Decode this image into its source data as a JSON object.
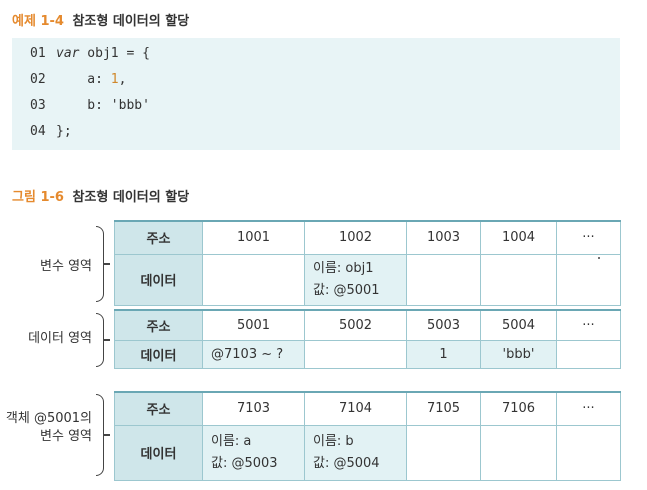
{
  "example": {
    "number": "예제 1-4",
    "title": "참조형 데이터의 할당"
  },
  "code": [
    {
      "ln": "01",
      "parts": [
        {
          "t": "kw",
          "v": "var"
        },
        {
          "t": "plain",
          "v": " obj1 = {"
        }
      ]
    },
    {
      "ln": "02",
      "parts": [
        {
          "t": "plain",
          "v": "    a: "
        },
        {
          "t": "num",
          "v": "1"
        },
        {
          "t": "plain",
          "v": ","
        }
      ]
    },
    {
      "ln": "03",
      "parts": [
        {
          "t": "plain",
          "v": "    b: "
        },
        {
          "t": "str",
          "v": "'bbb'"
        }
      ]
    },
    {
      "ln": "04",
      "parts": [
        {
          "t": "plain",
          "v": "};"
        }
      ]
    }
  ],
  "figure": {
    "number": "그림 1-6",
    "title": "참조형 데이터의 할당"
  },
  "labels": {
    "address": "주소",
    "data": "데이터",
    "more": "···"
  },
  "groups": [
    {
      "name": "변수 영역",
      "addresses": [
        "1001",
        "1002",
        "1003",
        "1004"
      ],
      "cells": [
        [],
        [
          "이름: obj1",
          "값:  @5001"
        ],
        [],
        []
      ],
      "fill": [
        false,
        true,
        false,
        false
      ]
    },
    {
      "name": "데이터 영역",
      "addresses": [
        "5001",
        "5002",
        "5003",
        "5004"
      ],
      "cells": [
        [
          "@7103 ~ ?"
        ],
        [],
        [
          "1"
        ],
        [
          "'bbb'"
        ]
      ],
      "fill": [
        true,
        false,
        true,
        true
      ]
    },
    {
      "name": "객체 @5001의\n변수 영역",
      "addresses": [
        "7103",
        "7104",
        "7105",
        "7106"
      ],
      "cells": [
        [
          "이름: a",
          "값:  @5003"
        ],
        [
          "이름: b",
          "값:  @5004"
        ],
        [],
        []
      ],
      "fill": [
        true,
        true,
        false,
        false
      ]
    }
  ]
}
